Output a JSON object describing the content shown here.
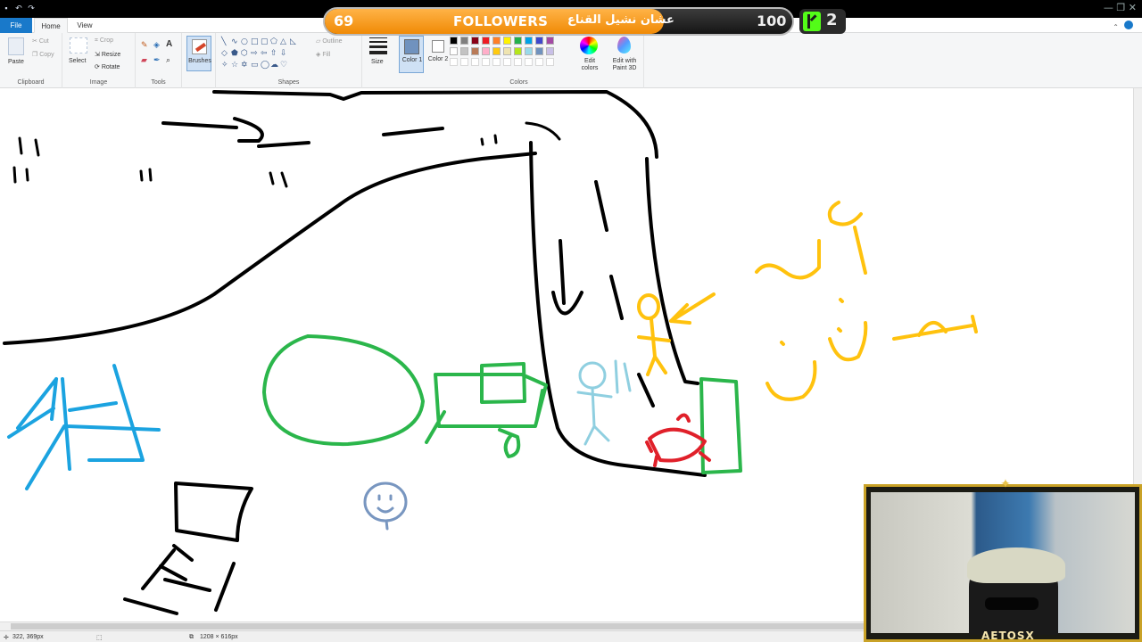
{
  "window": {
    "quick_access": [
      "save-icon",
      "undo-icon",
      "redo-icon"
    ],
    "controls": "— ❐ ✕"
  },
  "tabs": [
    {
      "label": "File"
    },
    {
      "label": "Home"
    },
    {
      "label": "View"
    }
  ],
  "ribbon": {
    "clipboard": {
      "paste": "Paste",
      "cut": "Cut",
      "copy": "Copy",
      "group": "Clipboard"
    },
    "image": {
      "select": "Select",
      "crop": "Crop",
      "resize": "Resize",
      "rotate": "Rotate",
      "group": "Image"
    },
    "tools": {
      "group": "Tools"
    },
    "brushes": {
      "label": "Brushes"
    },
    "shapes": {
      "outline": "Outline",
      "fill": "Fill",
      "group": "Shapes"
    },
    "size": {
      "label": "Size"
    },
    "colors": {
      "color1": "Color 1",
      "color2": "Color 2",
      "edit_colors": "Edit colors",
      "edit_paint3d": "Edit with Paint 3D",
      "group": "Colors",
      "palette_row1": [
        "#000000",
        "#7f7f7f",
        "#880015",
        "#ed1c24",
        "#ff7f27",
        "#fff200",
        "#22b14c",
        "#00a2e8",
        "#3f48cc",
        "#a349a4"
      ],
      "palette_row2": [
        "#ffffff",
        "#c3c3c3",
        "#b97a57",
        "#ffaec9",
        "#ffc90e",
        "#efe4b0",
        "#b5e61d",
        "#99d9ea",
        "#7092be",
        "#c8bfe7"
      ]
    }
  },
  "overlay": {
    "followers_count": "69",
    "followers_label": "FOLLOWERS",
    "followers_arabic": "عشان نشيل القناع",
    "followers_goal": "100",
    "kick_count": "2",
    "progress": 0.69
  },
  "status": {
    "cursor": "322, 369px",
    "canvas_size": "1208 × 616px"
  },
  "webcam": {
    "name": "AETOSX"
  }
}
